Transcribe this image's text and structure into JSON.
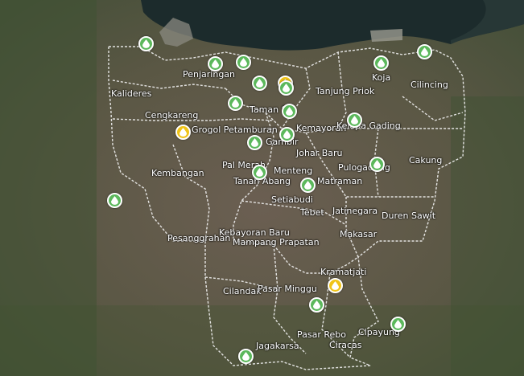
{
  "map": {
    "colors": {
      "land": "#55573f",
      "sea": "#1c2b2c",
      "boundary": "#f2f2f2",
      "marker_green": "#5cb85c",
      "marker_yellow": "#f0c419"
    },
    "marker_icon": "water-drop-icon",
    "districts": [
      {
        "name": "Penjaringan"
      },
      {
        "name": "Kalideres"
      },
      {
        "name": "Koja"
      },
      {
        "name": "Cilincing"
      },
      {
        "name": "Tanjung Priok"
      },
      {
        "name": "Cengkareng"
      },
      {
        "name": "Taman S"
      },
      {
        "name": "Grogol Petamburan"
      },
      {
        "name": "Kemayoran"
      },
      {
        "name": "Kelapa Gading"
      },
      {
        "name": "Gambir"
      },
      {
        "name": "Johar Baru"
      },
      {
        "name": "Kembangan"
      },
      {
        "name": "Pal Merah"
      },
      {
        "name": "Menteng"
      },
      {
        "name": "Pulogadung"
      },
      {
        "name": "Cakung"
      },
      {
        "name": "Tanah Abang"
      },
      {
        "name": "Matraman"
      },
      {
        "name": "Setiabudi"
      },
      {
        "name": "Tebet"
      },
      {
        "name": "Jatinegara"
      },
      {
        "name": "Duren Sawit"
      },
      {
        "name": "Kebayoran Baru"
      },
      {
        "name": "Pesanggrahan"
      },
      {
        "name": "Mampang Prapatan"
      },
      {
        "name": "Makasar"
      },
      {
        "name": "Kramatjati"
      },
      {
        "name": "Cilandak"
      },
      {
        "name": "Pasar Minggu"
      },
      {
        "name": "Pasar Rebo"
      },
      {
        "name": "Cipayung"
      },
      {
        "name": "Jagakarsa"
      },
      {
        "name": "Ciracas"
      }
    ],
    "markers": [
      {
        "status": "green"
      },
      {
        "status": "green"
      },
      {
        "status": "green"
      },
      {
        "status": "green"
      },
      {
        "status": "yellow"
      },
      {
        "status": "green"
      },
      {
        "status": "green"
      },
      {
        "status": "green"
      },
      {
        "status": "green"
      },
      {
        "status": "green"
      },
      {
        "status": "yellow"
      },
      {
        "status": "green"
      },
      {
        "status": "green"
      },
      {
        "status": "green"
      },
      {
        "status": "green"
      },
      {
        "status": "green"
      },
      {
        "status": "green"
      },
      {
        "status": "green"
      },
      {
        "status": "yellow"
      },
      {
        "status": "green"
      },
      {
        "status": "green"
      },
      {
        "status": "green"
      },
      {
        "status": "green"
      }
    ]
  }
}
